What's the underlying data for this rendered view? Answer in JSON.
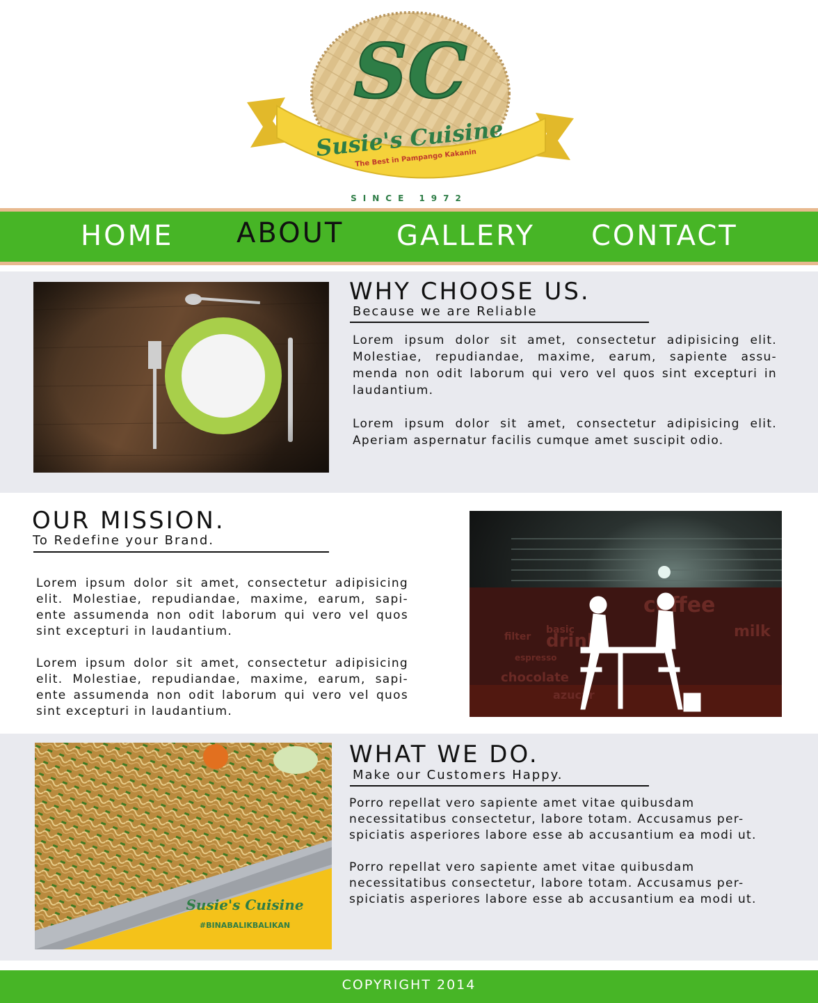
{
  "brand": {
    "monogram": "SC",
    "name": "Susie's Cuisine",
    "tagline": "The Best in Pampango Kakanin",
    "since": "SINCE 1972"
  },
  "nav": {
    "items": [
      {
        "label": "HOME",
        "active": false
      },
      {
        "label": "ABOUT",
        "active": true
      },
      {
        "label": "GALLERY",
        "active": false
      },
      {
        "label": "CONTACT",
        "active": false
      }
    ]
  },
  "sections": {
    "why": {
      "title": "WHY CHOOSE US.",
      "subtitle": "Because we are Reliable",
      "p1": "Lorem ipsum dolor sit amet, consectetur adipisicing elit. Molestiae, repudiandae, maxime, earum, sapiente assu-menda non odit laborum qui vero vel quos sint excepturi in laudantium.",
      "p2": "Lorem ipsum dolor sit amet, consectetur adipisicing elit. Aperiam aspernatur facilis cumque amet suscipit odio.",
      "image": "plate-cutlery-image"
    },
    "mission": {
      "title": "OUR MISSION.",
      "subtitle": "To Redefine your Brand.",
      "p1": "Lorem ipsum dolor sit amet, consectetur adipisicing elit. Molestiae, repudiandae, maxime, earum, sapi-ente assumenda non odit laborum qui vero vel quos sint excepturi in laudantium.",
      "p2": "Lorem ipsum dolor sit amet, consectetur adipisicing elit. Molestiae, repudiandae, maxime, earum, sapi-ente assumenda non odit laborum qui vero vel quos sint excepturi in laudantium.",
      "image": "coffee-shop-illustration",
      "image_words": [
        "coffee",
        "drink",
        "milk",
        "basic",
        "filter",
        "chocolate",
        "espresso",
        "azucar"
      ]
    },
    "what": {
      "title": "WHAT WE DO.",
      "subtitle": "Make our Customers Happy.",
      "p1": "Porro repellat vero sapiente amet vitae quibusdam necessitatibus consectetur, labore totam. Accusamus per-spiciatis asperiores labore esse ab accusantium ea modi ut.",
      "p2": "Porro repellat vero sapiente amet vitae quibusdam necessitatibus consectetur, labore totam. Accusamus per-spiciatis asperiores labore esse ab accusantium ea modi ut.",
      "image_brand": "Susie's Cuisine",
      "image_hashtag": "#BINABALIKBALIKAN"
    }
  },
  "footer": {
    "copyright": "COPYRIGHT 2014"
  },
  "colors": {
    "green": "#47b526",
    "accent_line": "#e8b98f",
    "band_grey": "#e9eaef",
    "logo_green": "#2e7d46",
    "ribbon_yellow": "#f5d23a"
  }
}
